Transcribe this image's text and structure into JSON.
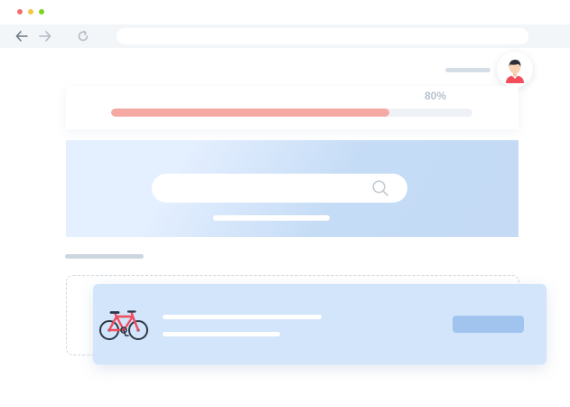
{
  "browser": {
    "controls": [
      "close",
      "minimize",
      "maximize"
    ],
    "icons": {
      "back": "back-arrow-icon",
      "forward": "forward-arrow-icon",
      "reload": "reload-icon"
    }
  },
  "header": {
    "avatar_icon": "user-avatar-icon"
  },
  "progress": {
    "label": "80%",
    "value": 0.77,
    "fill_color": "#f4a9a3",
    "track_color": "#eef2f6"
  },
  "hero": {
    "search_icon": "search-icon",
    "colors": [
      "#e4efff",
      "#c4daf5"
    ]
  },
  "item": {
    "icon": "bicycle-icon",
    "card_color": "#d3e5fb",
    "button_color": "#a1c4ef"
  }
}
